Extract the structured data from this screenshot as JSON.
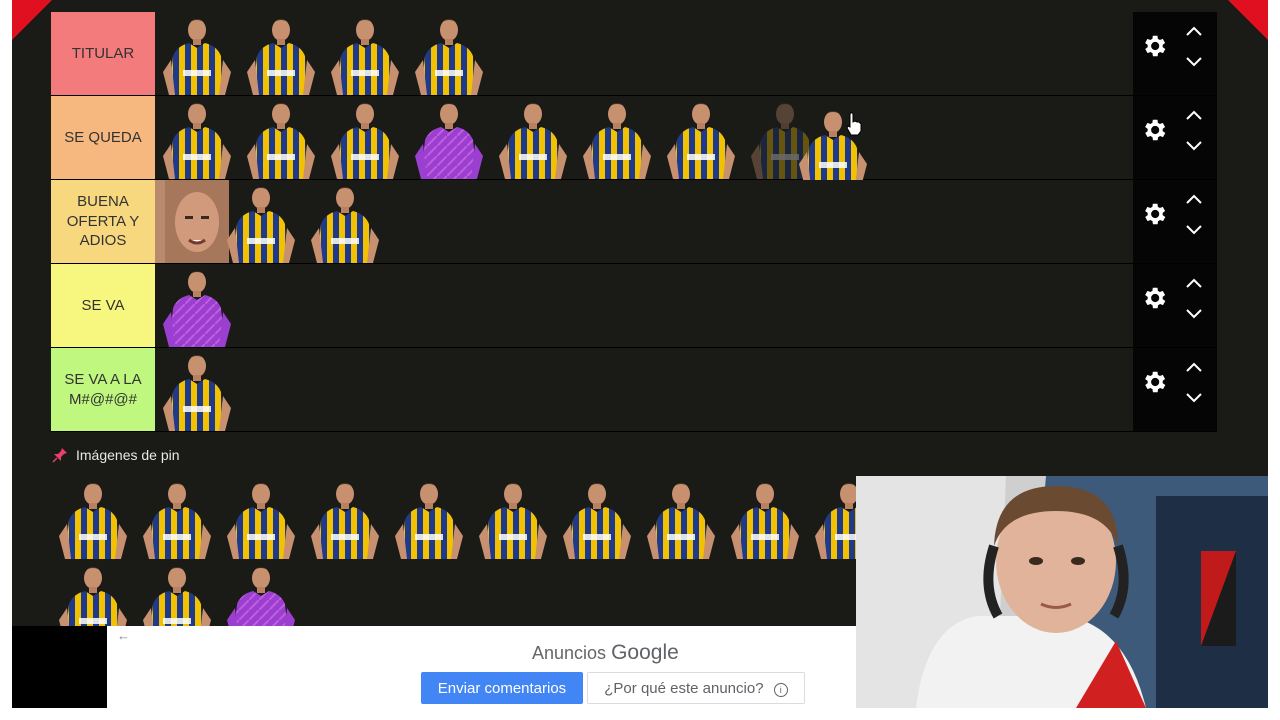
{
  "tiers": [
    {
      "label": "TITULAR",
      "color": "#f47b7b",
      "players": 4
    },
    {
      "label": "SE QUEDA",
      "color": "#f7b87f",
      "players": 9
    },
    {
      "label": "BUENA OFERTA Y ADIOS",
      "color": "#f7d87f",
      "players": 3
    },
    {
      "label": "SE VA",
      "color": "#f7f77f",
      "players": 1
    },
    {
      "label": "SE VA A LA M#@#@#",
      "color": "#bff77f",
      "players": 1
    }
  ],
  "controls": {
    "gear_icon": "gear-icon",
    "up_icon": "chevron-up-icon",
    "down_icon": "chevron-down-icon"
  },
  "pin": {
    "label": "Imágenes de pin",
    "icon": "pushpin-icon",
    "icon_color": "#e8406a"
  },
  "ad": {
    "back_icon": "arrow-left-icon",
    "title_prefix": "Anuncios",
    "title_brand": "Google",
    "send_label": "Enviar comentarios",
    "why_label": "¿Por qué este anuncio?",
    "info_icon": "info-icon"
  },
  "colors": {
    "background": "#1a1a17",
    "jersey_blue": "#1f3a8a",
    "jersey_yellow": "#f2c200",
    "goalkeeper": "#9b3fd0",
    "accent_red": "#e01020"
  }
}
